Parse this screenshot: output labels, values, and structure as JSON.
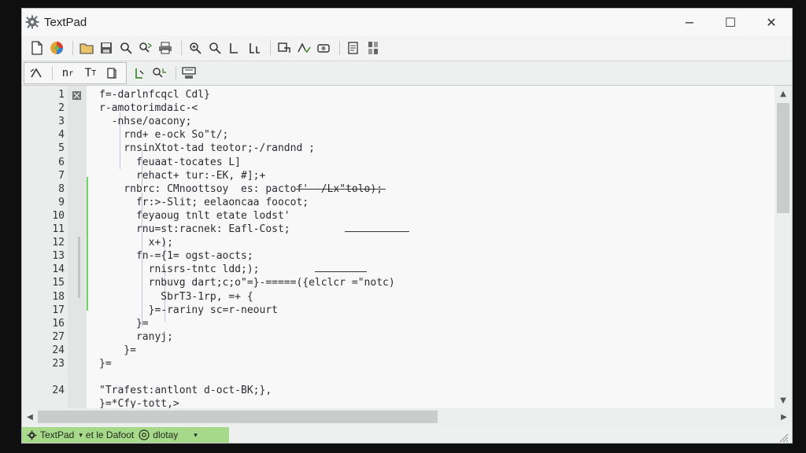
{
  "window": {
    "title": "TextPad",
    "controls": {
      "minimize": "−",
      "maximize": "☐",
      "close": "✕"
    }
  },
  "toolbar_main": {
    "icons": [
      "new-file-icon",
      "open-colorful-icon",
      "folder-icon",
      "save-icon",
      "find-icon",
      "find-replace-icon",
      "print-icon",
      "zoom-in-icon",
      "zoom-out-icon",
      "undo-icon",
      "redo-icon",
      "indent-icon",
      "spellcheck-icon",
      "tool-icon",
      "settings-icon"
    ]
  },
  "toolbar_secondary": {
    "labels": [
      "n",
      "T",
      "T"
    ],
    "icons": [
      "bookmark-icon",
      "book-icon",
      "format-icon",
      "markers-icon",
      "layout-icon"
    ]
  },
  "editor": {
    "line_numbers": [
      "1",
      "2",
      "3",
      "4",
      "5",
      "6",
      "7",
      "8",
      "9",
      "10",
      "11",
      "12",
      "13",
      "14",
      "15",
      "18",
      "17",
      "16",
      "27",
      "24",
      "23",
      "24"
    ],
    "lines": [
      "f=-darlnfcqcl Cdl}",
      "r-amotorimdaic-<",
      "  -nhse/oacony;",
      "    rnd+ e-ock So\"t/;",
      "    rnsinXtot-tad teotor;-/randnd ;",
      "      feuaat-tocates L]",
      "      rehact+ tur:-EK, #];+",
      "    rnbrc: CMnoottsoy  es: pactof' -/Lx\"tolo);",
      "      fr:>-Slit; eelaoncaa foocot;",
      "      feyaoug tnlt etate lodst'",
      "      rnu=st:racnek: Eafl-Cost;",
      "        x+);",
      "      fn-={1= ogst-aocts;",
      "        rnisrs-tntc ldd;);",
      "        rnbuvg dart;c;o\"=}-=====({elclcr =\"notc)",
      "          SbrT3-1rp, =+ {",
      "        }=-rariny sc=r-neourt",
      "      }=",
      "      ranyj;",
      "    }=",
      "}=",
      "",
      "\"Trafest:antlont d-oct-BK;},",
      "}=*Cfy-tott,>"
    ],
    "underscores": [
      "7",
      "10",
      "13"
    ]
  },
  "statusbar": {
    "app_label": "TextPad",
    "dropdown_label": "et le Dafoot",
    "mode_label": "dlotay"
  },
  "colors": {
    "accent_green": "#a6d98a",
    "change_bar_green": "#6fd16a",
    "fold_guide": "#c7c0d8",
    "code_text": "#2b2b33"
  }
}
